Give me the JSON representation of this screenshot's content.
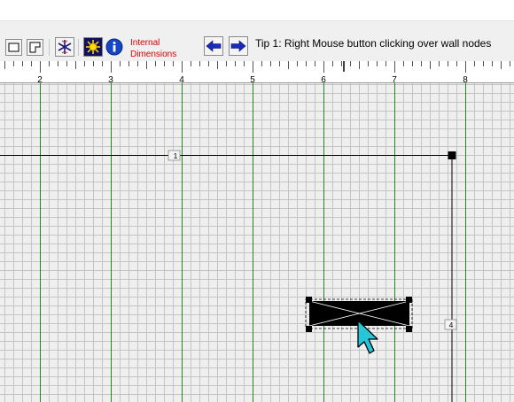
{
  "toolbar": {
    "buttons": [
      {
        "name": "rect-wall-tool",
        "icon": "square-outline-icon"
      },
      {
        "name": "l-shape-wall-tool",
        "icon": "l-shape-outline-icon"
      },
      {
        "name": "snowflake-tool",
        "icon": "snowflake-icon"
      },
      {
        "name": "sun-tool",
        "icon": "sun-icon"
      },
      {
        "name": "info-tool",
        "icon": "info-icon"
      },
      {
        "name": "prev-tip",
        "icon": "arrow-left-icon"
      },
      {
        "name": "next-tip",
        "icon": "arrow-right-icon"
      }
    ],
    "internal_dimensions_line1": "Internal",
    "internal_dimensions_line2": "Dimensions",
    "tip": "Tip 1: Right Mouse button clicking over wall nodes"
  },
  "ruler": {
    "labels": [
      "2",
      "3",
      "4",
      "5",
      "6",
      "7",
      "8"
    ]
  },
  "canvas": {
    "wall_labels": [
      "1",
      "4"
    ],
    "colors": {
      "grid_minor": "#c4c4c4",
      "grid_major": "#1c8a1c",
      "wall": "#000000",
      "selected_item": "#000000",
      "cursor": "#26c6d8"
    }
  }
}
